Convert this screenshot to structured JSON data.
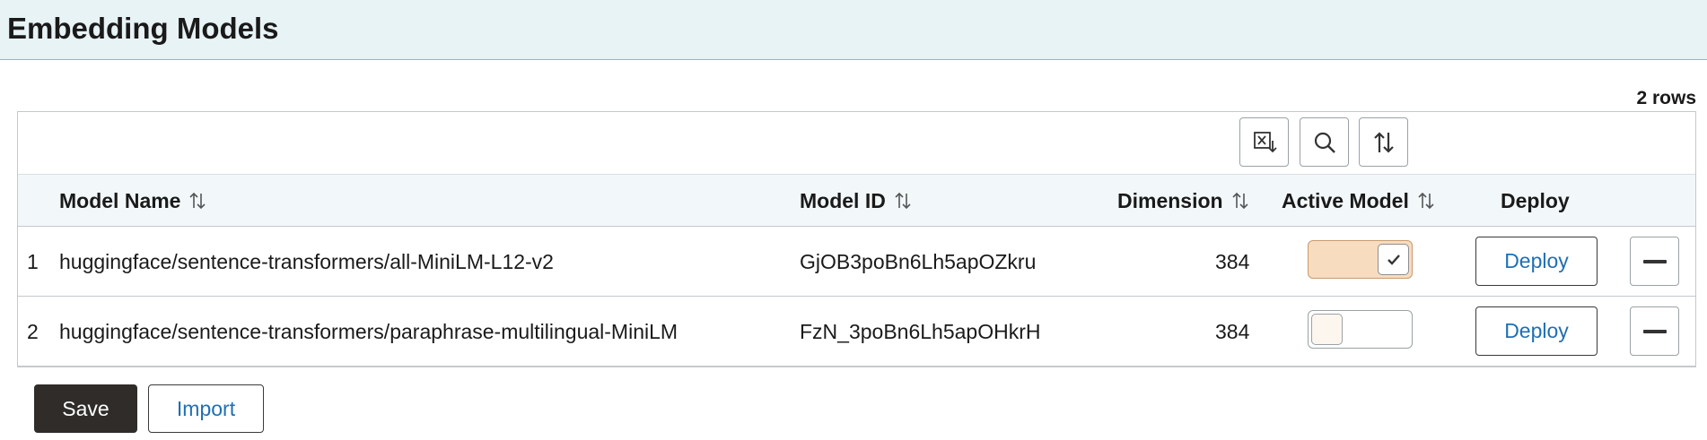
{
  "page": {
    "title": "Embedding Models"
  },
  "grid": {
    "row_count": "2 rows",
    "toolbar": {
      "export_icon": "excel-export-icon",
      "search_icon": "search-icon",
      "sort_icon": "sort-icon"
    },
    "columns": {
      "model_name": "Model Name",
      "model_id": "Model ID",
      "dimension": "Dimension",
      "active_model": "Active Model",
      "deploy": "Deploy"
    },
    "rows": [
      {
        "num": "1",
        "model_name": "huggingface/sentence-transformers/all-MiniLM-L12-v2",
        "model_id": "GjOB3poBn6Lh5apOZkru",
        "dimension": "384",
        "active": true,
        "deploy_label": "Deploy"
      },
      {
        "num": "2",
        "model_name": "huggingface/sentence-transformers/paraphrase-multilingual-MiniLM",
        "model_id": "FzN_3poBn6Lh5apOHkrH",
        "dimension": "384",
        "active": false,
        "deploy_label": "Deploy"
      }
    ]
  },
  "footer": {
    "save_label": "Save",
    "import_label": "Import"
  },
  "colors": {
    "header_bg": "#e8f3f5",
    "link_blue": "#1f6fb3",
    "toggle_on": "#f8dcc0",
    "save_bg": "#2f2c2a"
  }
}
